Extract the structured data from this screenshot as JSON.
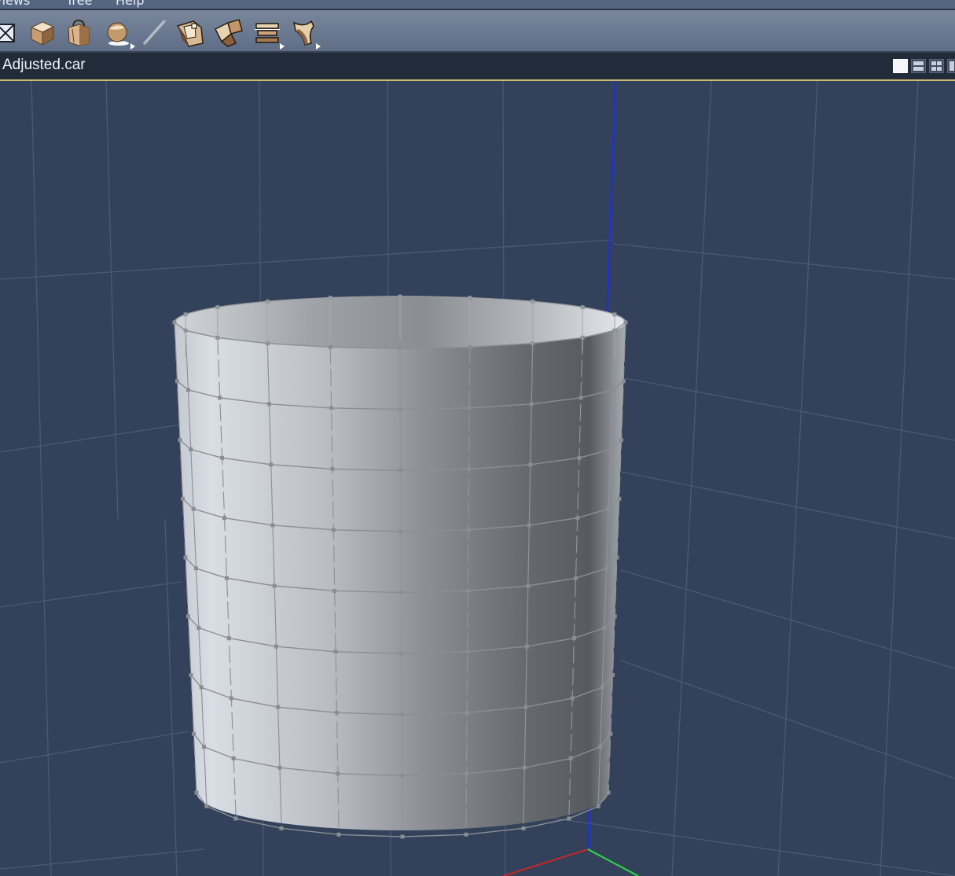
{
  "menubar": {
    "items": [
      {
        "label": "Views"
      },
      {
        "label": "Tree"
      },
      {
        "label": "Help"
      }
    ]
  },
  "toolbar": {
    "tools": [
      {
        "icon": "close-box-icon"
      },
      {
        "icon": "box-primitive-icon"
      },
      {
        "icon": "bag-primitive-icon"
      },
      {
        "icon": "sphere-primitive-icon"
      },
      {
        "icon": "pen-tool-icon"
      },
      {
        "icon": "twist-deformer-icon"
      },
      {
        "icon": "fold-deformer-icon"
      },
      {
        "icon": "slice-deformer-icon"
      },
      {
        "icon": "bend-deformer-icon"
      }
    ]
  },
  "viewport": {
    "title": "Adjusted.car",
    "layouts": [
      "single-view",
      "two-views-horizontal",
      "four-views",
      "three-views"
    ],
    "axis_colors": {
      "x": "#c0292a",
      "y": "#2bd04b",
      "z": "#1d2fe8"
    },
    "background": "#33425a",
    "grid_color": "#4a5a73"
  },
  "mesh": {
    "object": "cylinder",
    "columns": 10,
    "rows": 8,
    "color": "#b9bec6"
  }
}
